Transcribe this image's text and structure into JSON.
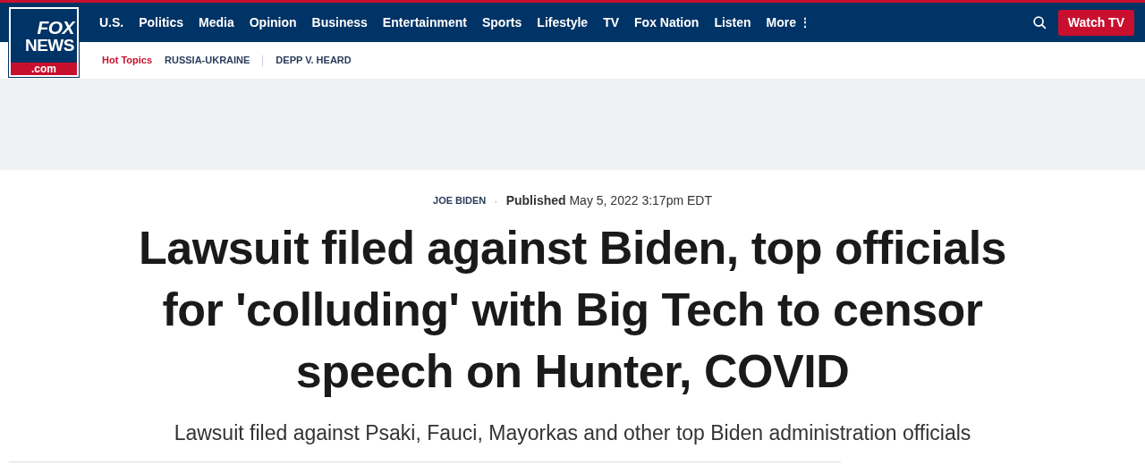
{
  "logo": {
    "line_1": "FOX",
    "line_2": "NEWS",
    "line_3": ".com"
  },
  "nav": {
    "items": [
      {
        "label": "U.S."
      },
      {
        "label": "Politics"
      },
      {
        "label": "Media"
      },
      {
        "label": "Opinion"
      },
      {
        "label": "Business"
      },
      {
        "label": "Entertainment"
      },
      {
        "label": "Sports"
      },
      {
        "label": "Lifestyle"
      },
      {
        "label": "TV"
      },
      {
        "label": "Fox Nation"
      },
      {
        "label": "Listen"
      }
    ],
    "more": "More",
    "more_icon": "⋮",
    "watch_button": "Watch TV"
  },
  "hot_topics": {
    "label": "Hot Topics",
    "items": [
      "RUSSIA-UKRAINE",
      "DEPP V. HEARD"
    ]
  },
  "article": {
    "category": "JOE BIDEN",
    "separator": "·",
    "published_label": "Published",
    "published_date": "May 5, 2022 3:17pm EDT",
    "headline": "Lawsuit filed against Biden, top officials for 'colluding' with Big Tech to censor speech on Hunter, COVID",
    "subheadline": "Lawsuit filed against Psaki, Fauci, Mayorkas and other top Biden administration officials"
  }
}
